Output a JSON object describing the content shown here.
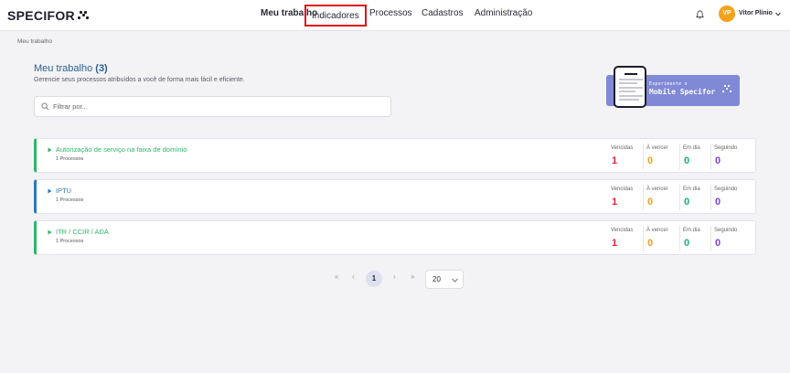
{
  "header": {
    "logo": "SPECIFOR",
    "nav": [
      {
        "label": "Meu trabalho",
        "state": "active"
      },
      {
        "label": "Indicadores",
        "state": "highlighted"
      },
      {
        "label": "Processos",
        "state": "normal"
      },
      {
        "label": "Cadastros",
        "state": "normal"
      },
      {
        "label": "Administração",
        "state": "normal"
      }
    ],
    "user": {
      "initials": "VP",
      "name": "Vitor Plínio",
      "avatar_color": "#f5a21b"
    }
  },
  "breadcrumb": "Meu trabalho",
  "page": {
    "title": "Meu trabalho",
    "count": "(3)",
    "subtitle": "Gerencie seus processos atribuídos a você de forma mais fácil e eficiente.",
    "filter_placeholder": "Filtrar por..."
  },
  "promo": {
    "line1": "Experimente o",
    "line2": "Mobile Specifor",
    "bg_color": "#8089d6"
  },
  "stat_labels": [
    "Vencidas",
    "À vencer",
    "Em dia",
    "Seguindo"
  ],
  "stat_colors": [
    "#e02040",
    "#f5a21b",
    "#18b07a",
    "#7b3fe4"
  ],
  "groups": [
    {
      "name": "Autorização de serviço na faixa de domínio",
      "count_label": "1 Processos",
      "accent": "#2db56a",
      "stats": [
        "1",
        "0",
        "0",
        "0"
      ]
    },
    {
      "name": "IPTU",
      "count_label": "1 Processos",
      "accent": "#2a7ab8",
      "stats": [
        "1",
        "0",
        "0",
        "0"
      ]
    },
    {
      "name": "ITR / CCIR / ADA",
      "count_label": "1 Processos",
      "accent": "#2db56a",
      "stats": [
        "1",
        "0",
        "0",
        "0"
      ]
    }
  ],
  "pagination": {
    "first": "«",
    "prev": "‹",
    "current": "1",
    "next": "›",
    "last": "»",
    "page_size": "20"
  }
}
